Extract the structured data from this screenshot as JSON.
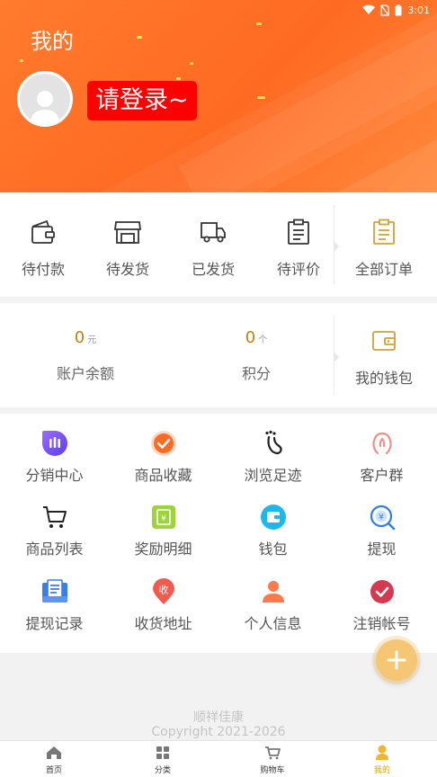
{
  "status_bar": {
    "time": "3:01"
  },
  "header": {
    "title": "我的",
    "login_label": "请登录~"
  },
  "orders": {
    "items": [
      {
        "label": "待付款",
        "icon": "wallet-icon"
      },
      {
        "label": "待发货",
        "icon": "store-icon"
      },
      {
        "label": "已发货",
        "icon": "truck-icon"
      },
      {
        "label": "待评价",
        "icon": "clipboard-icon"
      }
    ],
    "all_orders_label": "全部订单"
  },
  "wallet": {
    "balance_value": "0",
    "balance_unit": "元",
    "balance_label": "账户余额",
    "points_value": "0",
    "points_unit": "个",
    "points_label": "积分",
    "my_wallet_label": "我的钱包"
  },
  "features": [
    {
      "label": "分销中心",
      "icon": "distribution-icon"
    },
    {
      "label": "商品收藏",
      "icon": "favorite-check-icon"
    },
    {
      "label": "浏览足迹",
      "icon": "footprint-icon"
    },
    {
      "label": "客户群",
      "icon": "customer-group-icon"
    },
    {
      "label": "商品列表",
      "icon": "cart-icon"
    },
    {
      "label": "奖励明细",
      "icon": "reward-icon"
    },
    {
      "label": "钱包",
      "icon": "wallet-round-icon"
    },
    {
      "label": "提现",
      "icon": "withdraw-icon"
    },
    {
      "label": "提现记录",
      "icon": "withdraw-record-icon"
    },
    {
      "label": "收货地址",
      "icon": "address-pin-icon"
    },
    {
      "label": "个人信息",
      "icon": "person-icon"
    },
    {
      "label": "注销帐号",
      "icon": "cancel-account-icon"
    }
  ],
  "footer": {
    "brand": "顺祥佳康",
    "copyright": "Copyright 2021-2026"
  },
  "tabbar": {
    "items": [
      {
        "label": "首页",
        "icon": "home-icon"
      },
      {
        "label": "分类",
        "icon": "category-icon"
      },
      {
        "label": "购物车",
        "icon": "cart-tab-icon"
      },
      {
        "label": "我的",
        "icon": "me-icon",
        "active": true
      }
    ]
  },
  "colors": {
    "header": "#ff6a22",
    "login_button": "#ff0000",
    "accent_gold": "#d9a21f",
    "background": "#f2f2f2"
  }
}
